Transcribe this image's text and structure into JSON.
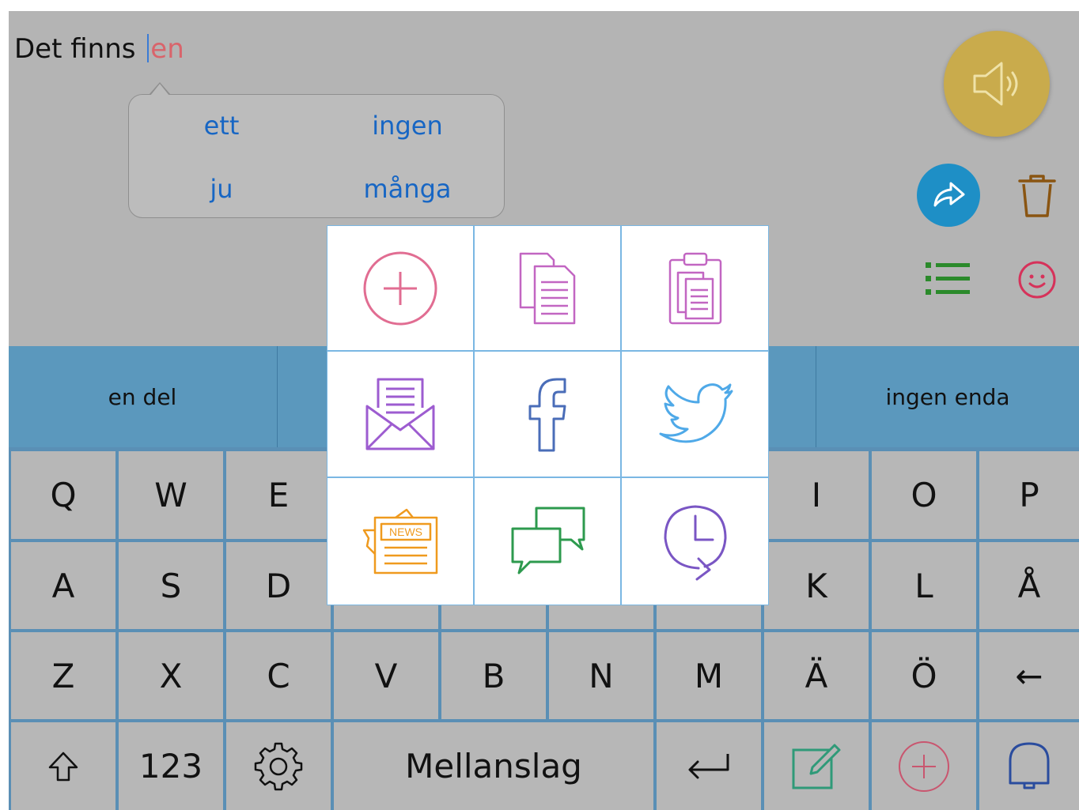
{
  "editor": {
    "text_before": "Det finns ",
    "current_word": "en"
  },
  "suggestions": [
    "ett",
    "ingen",
    "ju",
    "många"
  ],
  "phrases": [
    "en del",
    "ingen enda"
  ],
  "keyboard": {
    "row1": [
      "Q",
      "W",
      "E",
      "I",
      "O",
      "P"
    ],
    "row2": [
      "A",
      "S",
      "D",
      "K",
      "L",
      "Å"
    ],
    "row3": [
      "Z",
      "X",
      "C",
      "V",
      "B",
      "N",
      "M",
      "Ä",
      "Ö",
      "←"
    ],
    "row4": {
      "numbers": "123",
      "space": "Mellanslag"
    }
  },
  "share_menu": {
    "news_badge": "NEWS"
  },
  "icons": {
    "speak": "speaker-icon",
    "share": "share-arrow-icon",
    "delete": "trash-icon",
    "list": "list-icon",
    "emoji": "smiley-icon",
    "settings": "gear-icon",
    "shift": "shift-icon",
    "enter": "return-icon",
    "note": "edit-note-icon",
    "add": "add-icon",
    "bell": "bell-icon"
  },
  "colors": {
    "background": "#b4b4b4",
    "speak_button": "#c9ab4c",
    "share_button": "#1e8fc6",
    "phrase_bar": "#5b98bd",
    "key": "#b7b7b7",
    "key_border": "#5a8fb5",
    "suggestion_text": "#1766c4",
    "current_word": "#d9646b"
  }
}
